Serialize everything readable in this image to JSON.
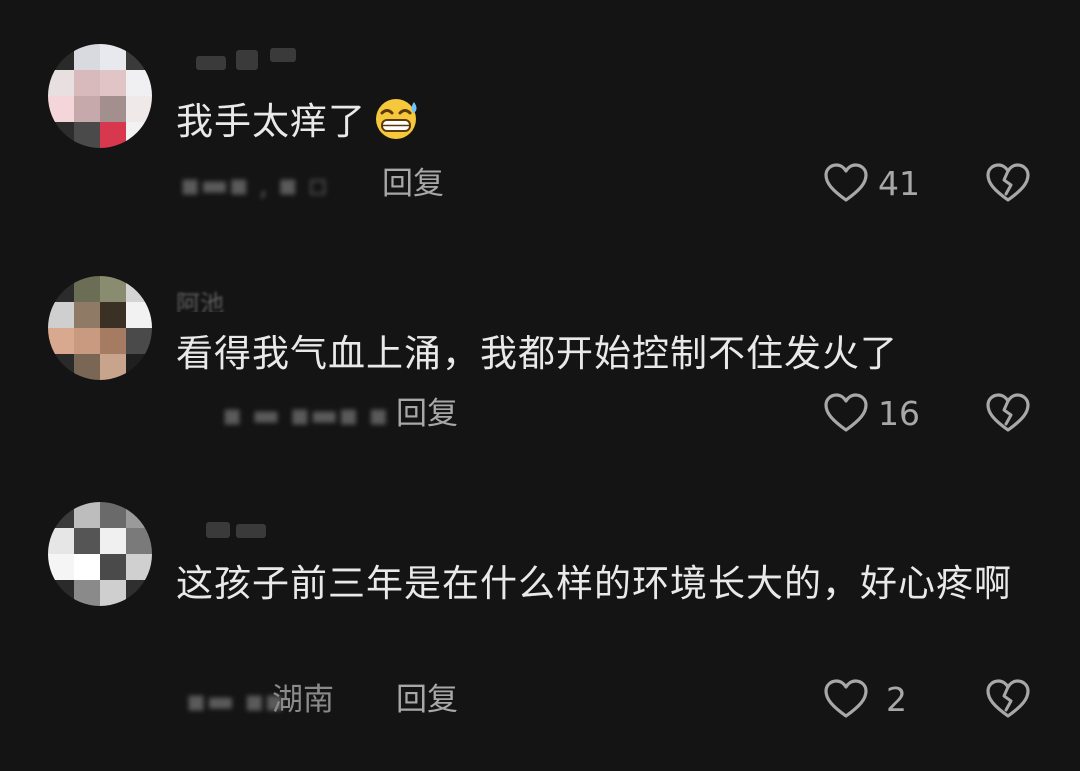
{
  "comments": [
    {
      "username": "",
      "text": "我手太痒了",
      "emoji": "grinning-sweat-emoji",
      "location": "",
      "reply_label": "回复",
      "likes": "41"
    },
    {
      "username": "阿池",
      "text": "看得我气血上涌，我都开始控制不住发火了",
      "location": "",
      "reply_label": "回复",
      "likes": "16"
    },
    {
      "username": "",
      "text": "这孩子前三年是在什么样的环境长大的，好心疼啊",
      "location": "湖南",
      "reply_label": "回复",
      "likes": "2"
    }
  ],
  "colors": {
    "background": "#141414",
    "text": "#e9e9e9",
    "secondary": "#a8a8a8"
  }
}
